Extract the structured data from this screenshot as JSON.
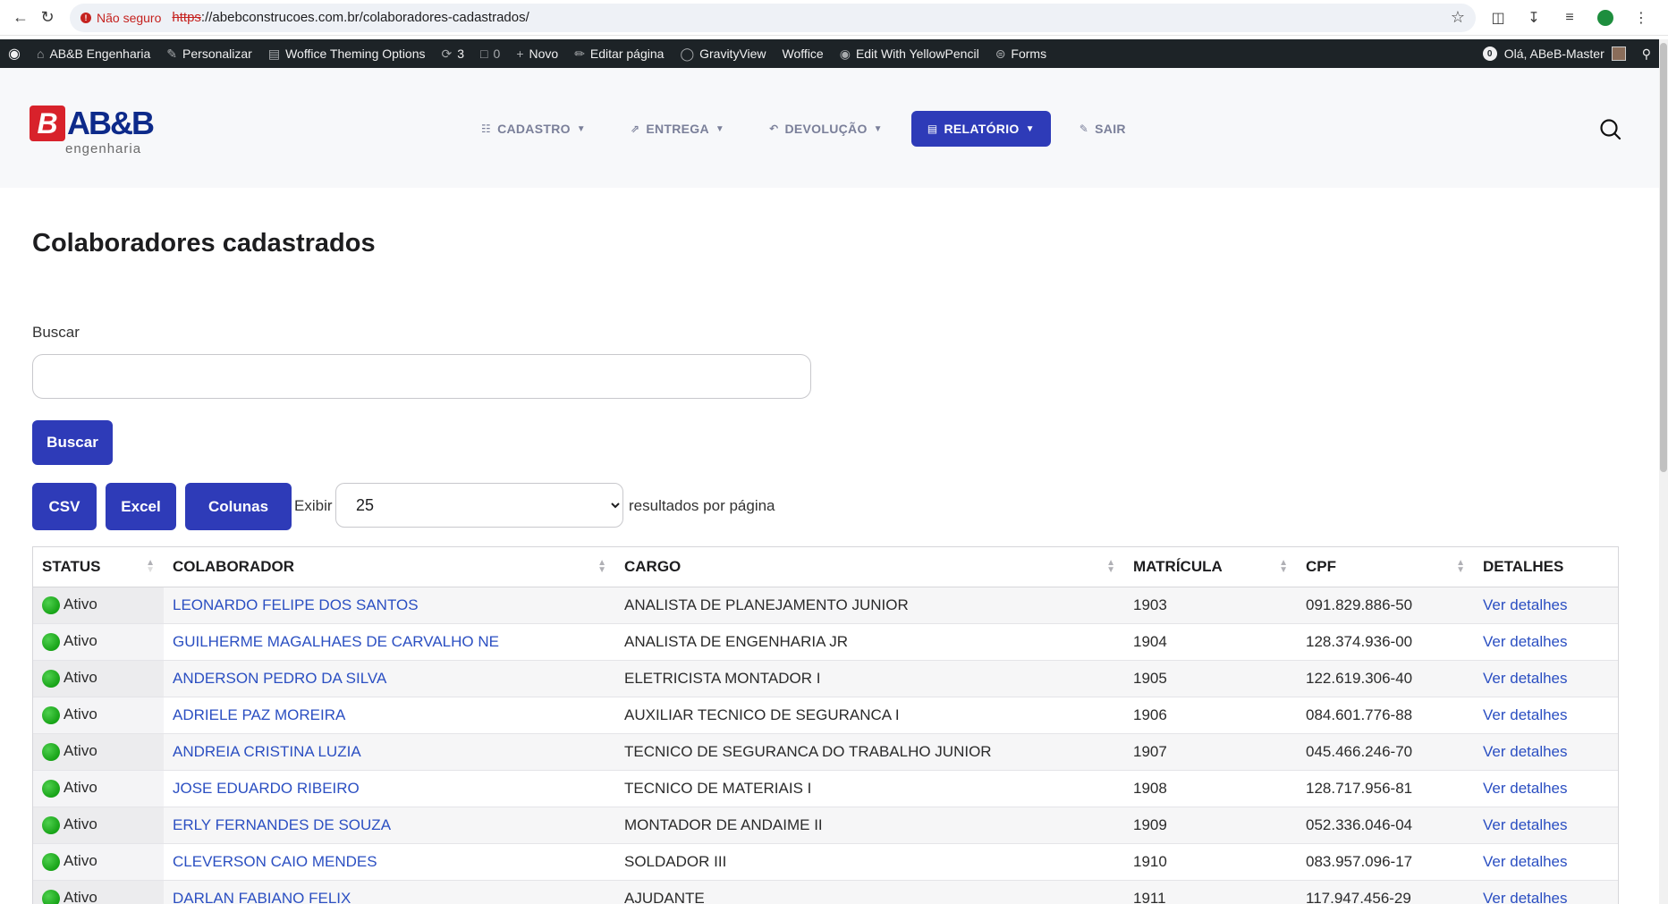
{
  "browser": {
    "security_label": "Não seguro",
    "url_scheme": "https",
    "url_rest": "://abebconstrucoes.com.br/colaboradores-cadastrados/"
  },
  "admin_bar": {
    "items": [
      {
        "label": "AB&B Engenharia",
        "icon": "home-icon"
      },
      {
        "label": "Personalizar",
        "icon": "brush-icon"
      },
      {
        "label": "Woffice Theming Options",
        "icon": "folder-icon"
      },
      {
        "label": "3",
        "icon": "refresh-icon"
      },
      {
        "label": "0",
        "icon": "comment-icon"
      },
      {
        "label": "Novo",
        "icon": "plus-icon"
      },
      {
        "label": "Editar página",
        "icon": "pencil-icon"
      },
      {
        "label": "GravityView",
        "icon": "astronaut-icon"
      },
      {
        "label": "Woffice",
        "icon": ""
      },
      {
        "label": "Edit With YellowPencil",
        "icon": "pencil-circle-icon"
      },
      {
        "label": "Forms",
        "icon": "forms-icon"
      }
    ],
    "badge": "0",
    "greeting": "Olá, ABeB-Master"
  },
  "logo": {
    "mark": "B",
    "text": "AB&B",
    "sub": "engenharia"
  },
  "nav": {
    "items": [
      {
        "label": "CADASTRO",
        "icon": "clipboard-icon"
      },
      {
        "label": "ENTREGA",
        "icon": "share-icon"
      },
      {
        "label": "DEVOLUÇÃO",
        "icon": "reply-icon"
      },
      {
        "label": "RELATÓRIO",
        "icon": "report-icon"
      },
      {
        "label": "SAIR",
        "icon": "edit-box-icon"
      }
    ]
  },
  "page": {
    "title": "Colaboradores cadastrados",
    "search_label": "Buscar",
    "search_value": "",
    "search_button": "Buscar",
    "csv_button": "CSV",
    "excel_button": "Excel",
    "columns_button": "Colunas",
    "exibir_label": "Exibir",
    "page_size": "25",
    "per_page_label": "resultados por página"
  },
  "colors": {
    "accent": "#2e3bb8",
    "link": "#2b4fc2",
    "status_active": "#17a317",
    "brand_red": "#d8222b",
    "brand_blue": "#0d2a8a"
  },
  "table": {
    "columns": [
      "STATUS",
      "COLABORADOR",
      "CARGO",
      "MATRÍCULA",
      "CPF",
      "DETALHES"
    ],
    "rows": [
      {
        "status": "Ativo",
        "name": "LEONARDO FELIPE DOS SANTOS",
        "role": "ANALISTA DE PLANEJAMENTO JUNIOR",
        "id": "1903",
        "cpf": "091.829.886-50",
        "details": "Ver detalhes"
      },
      {
        "status": "Ativo",
        "name": "GUILHERME MAGALHAES DE CARVALHO NE",
        "role": "ANALISTA DE ENGENHARIA JR",
        "id": "1904",
        "cpf": "128.374.936-00",
        "details": "Ver detalhes"
      },
      {
        "status": "Ativo",
        "name": "ANDERSON PEDRO DA SILVA",
        "role": "ELETRICISTA MONTADOR I",
        "id": "1905",
        "cpf": "122.619.306-40",
        "details": "Ver detalhes"
      },
      {
        "status": "Ativo",
        "name": "ADRIELE PAZ MOREIRA",
        "role": "AUXILIAR TECNICO DE SEGURANCA I",
        "id": "1906",
        "cpf": "084.601.776-88",
        "details": "Ver detalhes"
      },
      {
        "status": "Ativo",
        "name": "ANDREIA CRISTINA LUZIA",
        "role": "TECNICO DE SEGURANCA DO TRABALHO JUNIOR",
        "id": "1907",
        "cpf": "045.466.246-70",
        "details": "Ver detalhes"
      },
      {
        "status": "Ativo",
        "name": "JOSE EDUARDO RIBEIRO",
        "role": "TECNICO DE MATERIAIS I",
        "id": "1908",
        "cpf": "128.717.956-81",
        "details": "Ver detalhes"
      },
      {
        "status": "Ativo",
        "name": "ERLY FERNANDES DE SOUZA",
        "role": "MONTADOR DE ANDAIME II",
        "id": "1909",
        "cpf": "052.336.046-04",
        "details": "Ver detalhes"
      },
      {
        "status": "Ativo",
        "name": "CLEVERSON CAIO MENDES",
        "role": "SOLDADOR III",
        "id": "1910",
        "cpf": "083.957.096-17",
        "details": "Ver detalhes"
      },
      {
        "status": "Ativo",
        "name": "DARLAN FABIANO FELIX",
        "role": "AJUDANTE",
        "id": "1911",
        "cpf": "117.947.456-29",
        "details": "Ver detalhes"
      }
    ]
  }
}
